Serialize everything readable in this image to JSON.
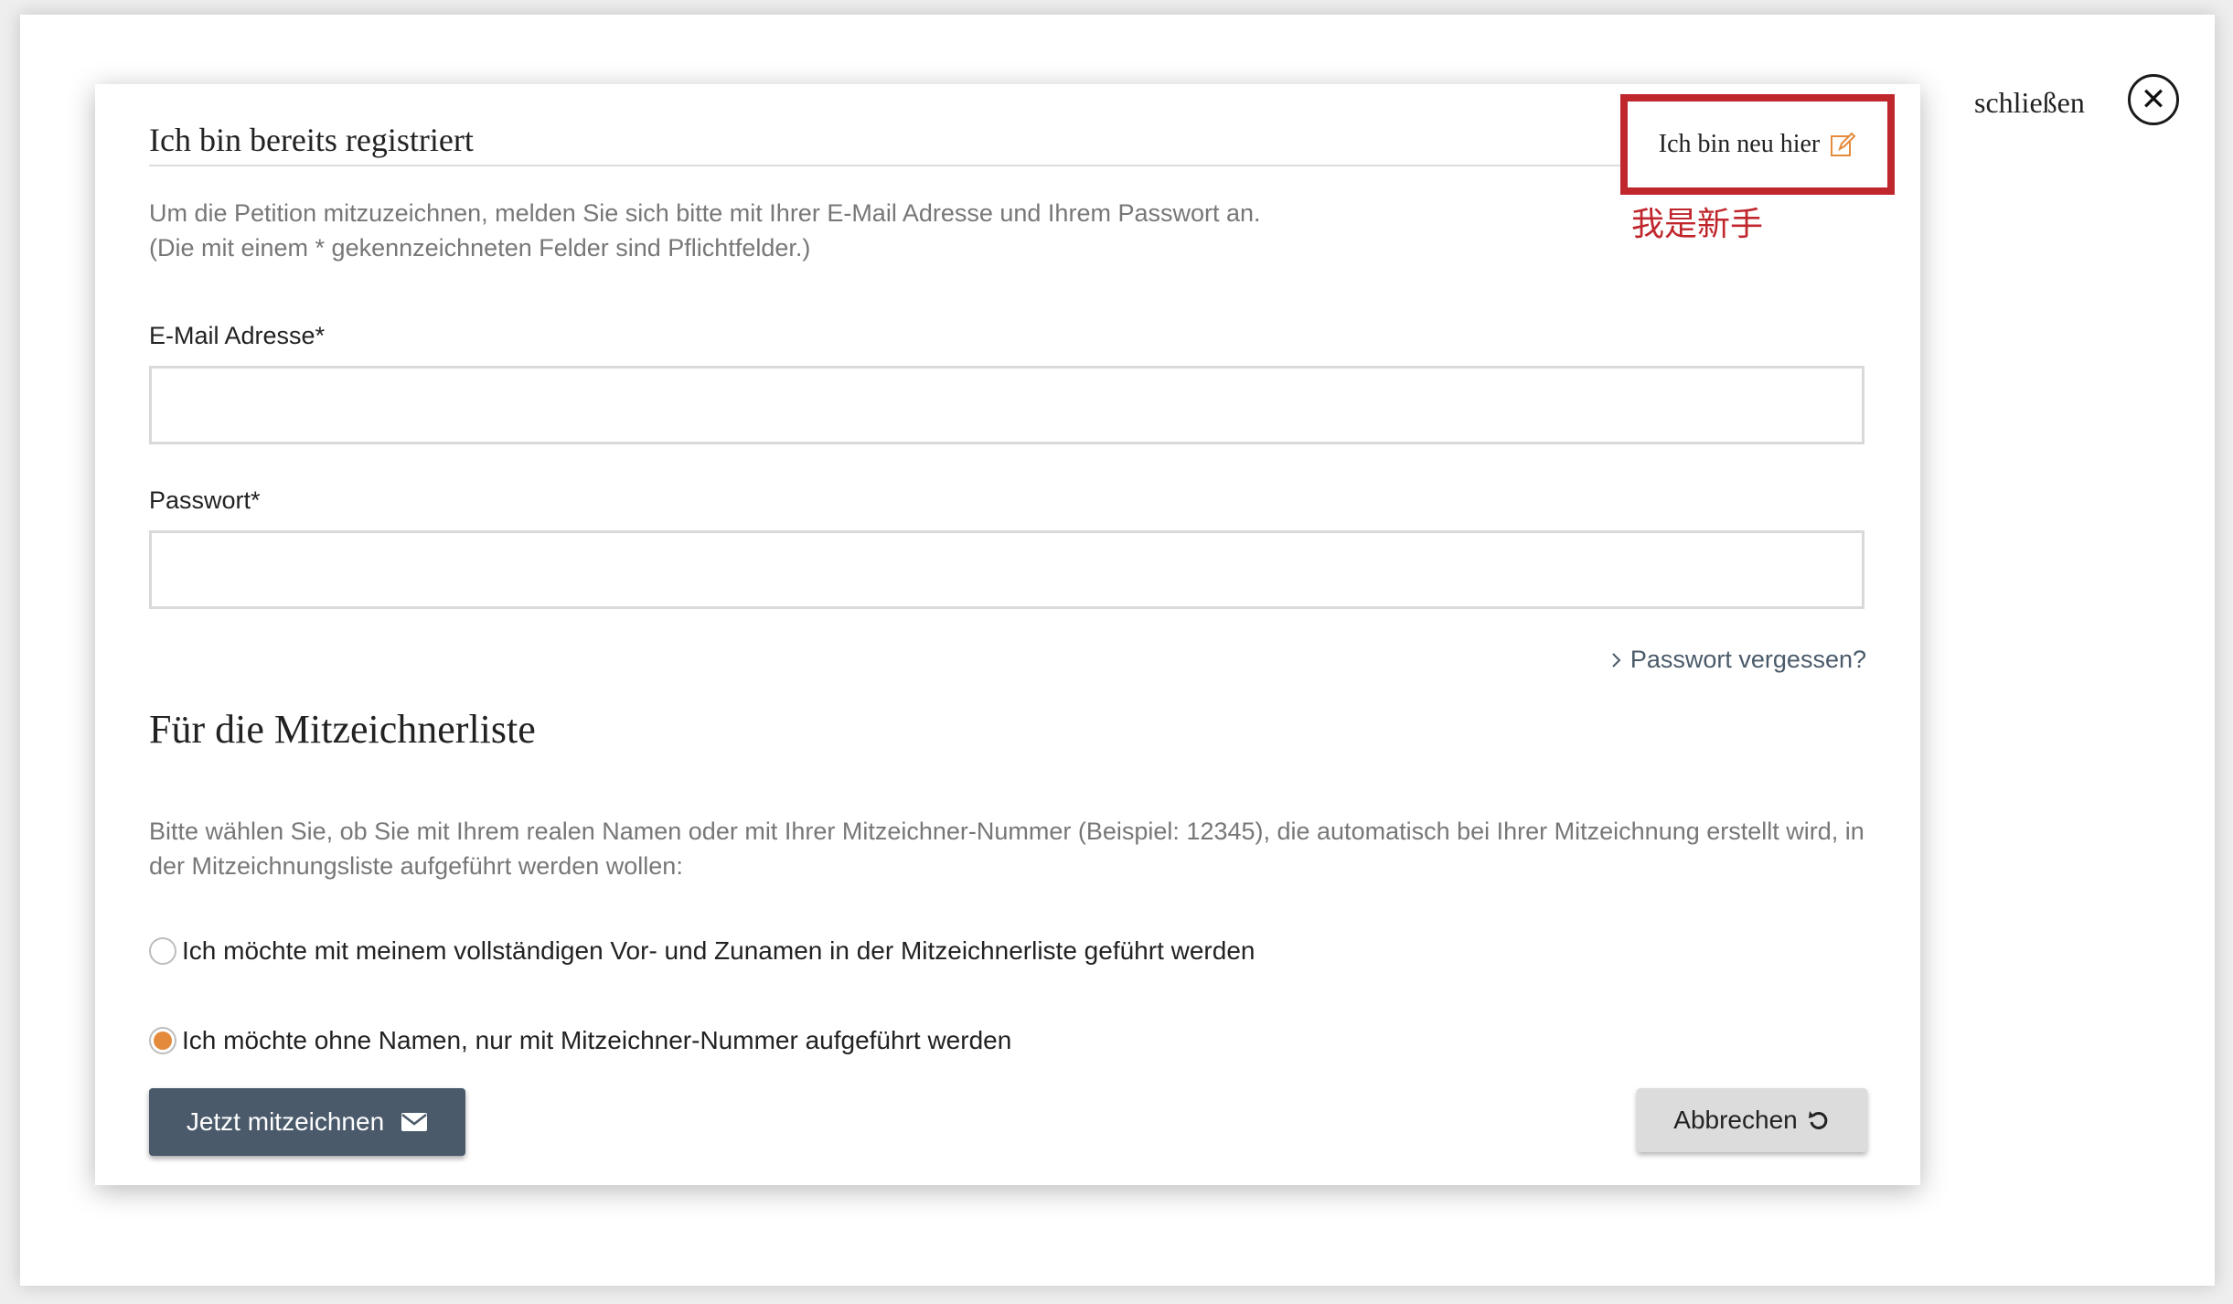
{
  "page": {
    "close_label": "schließen",
    "close_icon": "close-icon"
  },
  "modal": {
    "tab_active": "Ich bin bereits registriert",
    "tab_new": "Ich bin neu hier",
    "tab_new_icon": "edit-icon",
    "annotation": "我是新手",
    "intro_line1": "Um die Petition mitzuzeichnen, melden Sie sich bitte mit Ihrer E-Mail Adresse und Ihrem Passwort an.",
    "intro_line2": "(Die mit einem * gekennzeichneten Felder sind Pflichtfelder.)",
    "email_label": "E-Mail Adresse*",
    "email_value": "",
    "password_label": "Passwort*",
    "password_value": "",
    "forgot_password": "Passwort vergessen?",
    "section_title": "Für die Mitzeichnerliste",
    "section_desc": "Bitte wählen Sie, ob Sie mit Ihrem realen Namen oder mit Ihrer Mitzeichner-Nummer (Beispiel: 12345), die automatisch bei Ihrer Mitzeichnung erstellt wird, in der Mitzeichnungsliste aufgeführt werden wollen:",
    "options": [
      {
        "label": "Ich möchte mit meinem vollständigen Vor- und Zunamen in der Mitzeichnerliste geführt werden",
        "checked": false
      },
      {
        "label": "Ich möchte ohne Namen, nur mit Mitzeichner-Nummer aufgeführt werden",
        "checked": true
      }
    ],
    "submit_label": "Jetzt mitzeichnen",
    "submit_icon": "envelope-icon",
    "cancel_label": "Abbrechen",
    "cancel_icon": "undo-icon"
  },
  "colors": {
    "accent": "#e38a3c",
    "primary_button": "#4a5a6b",
    "highlight_border": "#c0272d"
  }
}
